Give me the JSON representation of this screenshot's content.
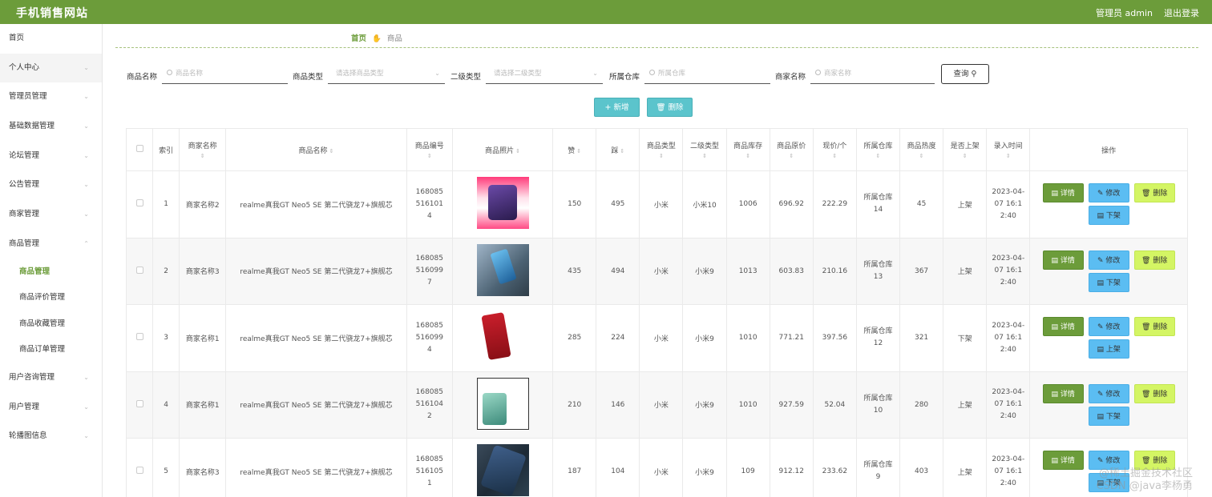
{
  "header": {
    "brand": "手机销售网站",
    "admin_label": "管理员 admin",
    "logout": "退出登录"
  },
  "sidebar": {
    "items": [
      {
        "label": "首页",
        "chevron": ""
      },
      {
        "label": "个人中心",
        "chevron": "⌄"
      },
      {
        "label": "管理员管理",
        "chevron": "⌄"
      },
      {
        "label": "基础数据管理",
        "chevron": "⌄"
      },
      {
        "label": "论坛管理",
        "chevron": "⌄"
      },
      {
        "label": "公告管理",
        "chevron": "⌄"
      },
      {
        "label": "商家管理",
        "chevron": "⌄"
      },
      {
        "label": "商品管理",
        "chevron": "⌃"
      }
    ],
    "sub_items": [
      "商品管理",
      "商品评价管理",
      "商品收藏管理",
      "商品订单管理"
    ],
    "items_after": [
      {
        "label": "用户咨询管理",
        "chevron": "⌄"
      },
      {
        "label": "用户管理",
        "chevron": "⌄"
      },
      {
        "label": "轮播图信息",
        "chevron": "⌄"
      }
    ]
  },
  "breadcrumb": {
    "home": "首页",
    "sep_icon": "✋",
    "current": "商品"
  },
  "search": {
    "product_name_label": "商品名称",
    "product_name_placeholder": "商品名称",
    "product_type_label": "商品类型",
    "product_type_placeholder": "请选择商品类型",
    "sub_type_label": "二级类型",
    "sub_type_placeholder": "请选择二级类型",
    "warehouse_label": "所属仓库",
    "warehouse_placeholder": "所属仓库",
    "merchant_label": "商家名称",
    "merchant_placeholder": "商家名称",
    "query_button": "查询"
  },
  "actions": {
    "add": "+ 新增",
    "delete": "删除"
  },
  "table": {
    "headers": {
      "index": "索引",
      "merchant": "商家名称",
      "name": "商品名称",
      "code": "商品编号",
      "photo": "商品照片",
      "like": "赞",
      "dislike": "踩",
      "type": "商品类型",
      "sub_type": "二级类型",
      "stock": "商品库存",
      "orig_price": "商品原价",
      "price": "现价/个",
      "warehouse": "所属仓库",
      "heat": "商品热度",
      "on_shelf": "是否上架",
      "created": "录入时间",
      "ops": "操作"
    },
    "rows": [
      {
        "index": "1",
        "merchant": "商家名称2",
        "name": "realme真我GT Neo5 SE 第二代骁龙7+旗舰芯",
        "code": "1680855161014",
        "like": "150",
        "dislike": "495",
        "type": "小米",
        "sub_type": "小米10",
        "stock": "1006",
        "orig_price": "696.92",
        "price": "222.29",
        "warehouse": "所属仓库14",
        "heat": "45",
        "on_shelf": "上架",
        "created": "2023-04-07 16:12:40",
        "shelf_btn": "下架"
      },
      {
        "index": "2",
        "merchant": "商家名称3",
        "name": "realme真我GT Neo5 SE 第二代骁龙7+旗舰芯",
        "code": "1680855160997",
        "like": "435",
        "dislike": "494",
        "type": "小米",
        "sub_type": "小米9",
        "stock": "1013",
        "orig_price": "603.83",
        "price": "210.16",
        "warehouse": "所属仓库13",
        "heat": "367",
        "on_shelf": "上架",
        "created": "2023-04-07 16:12:40",
        "shelf_btn": "下架"
      },
      {
        "index": "3",
        "merchant": "商家名称1",
        "name": "realme真我GT Neo5 SE 第二代骁龙7+旗舰芯",
        "code": "1680855160994",
        "like": "285",
        "dislike": "224",
        "type": "小米",
        "sub_type": "小米9",
        "stock": "1010",
        "orig_price": "771.21",
        "price": "397.56",
        "warehouse": "所属仓库12",
        "heat": "321",
        "on_shelf": "下架",
        "created": "2023-04-07 16:12:40",
        "shelf_btn": "上架"
      },
      {
        "index": "4",
        "merchant": "商家名称1",
        "name": "realme真我GT Neo5 SE 第二代骁龙7+旗舰芯",
        "code": "1680855161042",
        "like": "210",
        "dislike": "146",
        "type": "小米",
        "sub_type": "小米9",
        "stock": "1010",
        "orig_price": "927.59",
        "price": "52.04",
        "warehouse": "所属仓库10",
        "heat": "280",
        "on_shelf": "上架",
        "created": "2023-04-07 16:12:40",
        "shelf_btn": "下架"
      },
      {
        "index": "5",
        "merchant": "商家名称3",
        "name": "realme真我GT Neo5 SE 第二代骁龙7+旗舰芯",
        "code": "1680855161051",
        "like": "187",
        "dislike": "104",
        "type": "小米",
        "sub_type": "小米9",
        "stock": "109",
        "orig_price": "912.12",
        "price": "233.62",
        "warehouse": "所属仓库9",
        "heat": "403",
        "on_shelf": "上架",
        "created": "2023-04-07 16:12:40",
        "shelf_btn": "下架"
      }
    ],
    "row_buttons": {
      "detail": "详情",
      "edit": "修改",
      "delete": "删除"
    }
  },
  "watermark": {
    "line1": "@稀土掘金技术社区",
    "line2": "CSDN @java李杨勇"
  },
  "colors": {
    "brand_green": "#6c9c3a",
    "teal": "#5bc4cc",
    "blue": "#5bbdf2",
    "lime": "#d4f564"
  }
}
